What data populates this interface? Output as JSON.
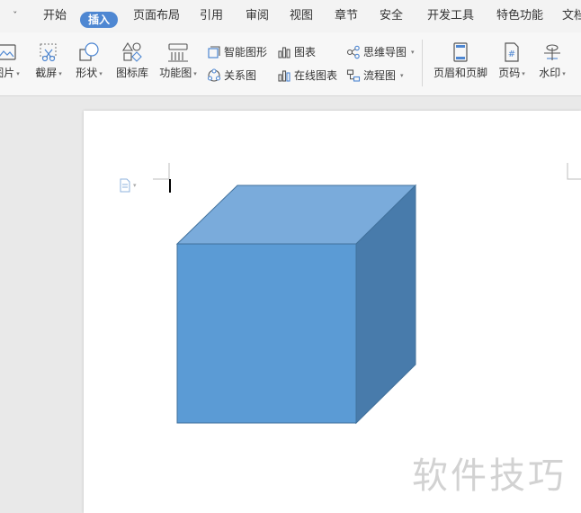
{
  "tabs": {
    "chevron": "ˇ",
    "items": [
      "开始",
      "插入",
      "页面布局",
      "引用",
      "审阅",
      "视图",
      "章节",
      "安全",
      "开发工具",
      "特色功能",
      "文档"
    ],
    "active_index": 1
  },
  "toolbar": {
    "picture": "图片",
    "screenshot": "截屏",
    "shapes": "形状",
    "icon_library": "图标库",
    "function_chart": "功能图",
    "smart_shape": "智能图形",
    "chart": "图表",
    "mind_map": "思维导图",
    "relation_chart": "关系图",
    "online_chart": "在线图表",
    "flowchart": "流程图",
    "header_footer": "页眉和页脚",
    "page_number": "页码",
    "watermark": "水印"
  },
  "document": {
    "watermark_text": "软件技巧"
  },
  "colors": {
    "accent": "#4e87d2",
    "cube_front": "#5b9bd5",
    "cube_top": "#7aabdb",
    "cube_side": "#487bab",
    "cube_stroke": "#41719c"
  }
}
